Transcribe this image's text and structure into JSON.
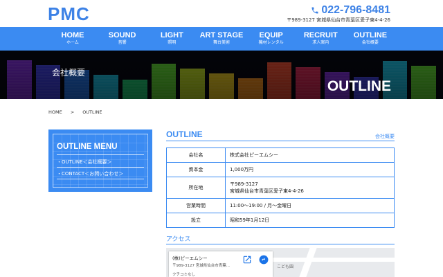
{
  "header": {
    "logo": "PMC",
    "phone": "022-796-8481",
    "address": "〒989-3127 宮城県仙台市青葉区愛子東4-4-26"
  },
  "nav": [
    {
      "en": "HOME",
      "jp": "ホーム"
    },
    {
      "en": "SOUND",
      "jp": "音響"
    },
    {
      "en": "LIGHT",
      "jp": "照明"
    },
    {
      "en": "ART STAGE",
      "jp": "舞台美術"
    },
    {
      "en": "EQUIP",
      "jp": "機材レンタル"
    },
    {
      "en": "RECRUIT",
      "jp": "求人案内"
    },
    {
      "en": "OUTLINE",
      "jp": "会社概要"
    }
  ],
  "hero": {
    "title_jp": "会社概要",
    "title_en": "OUTLINE",
    "bar_colors": [
      "#7a2bd0",
      "#3a3bd8",
      "#1e6ee0",
      "#16b8d8",
      "#19c26a",
      "#5ad02a",
      "#b8d51c",
      "#e6c41a",
      "#ee8a18",
      "#e5482a",
      "#d2244f",
      "#7a2bd0",
      "#3a3bd8",
      "#16b8d8",
      "#5ad02a"
    ]
  },
  "breadcrumb": {
    "home": "HOME",
    "sep": ">",
    "current": "OUTLINE"
  },
  "sidebar": {
    "title": "OUTLINE MENU",
    "links": [
      "・OUTLINE＜会社概要＞",
      "・CONTACT＜お問い合わせ＞"
    ]
  },
  "section": {
    "title": "OUTLINE",
    "subtitle": "会社概要"
  },
  "company_table": [
    {
      "label": "会社名",
      "value": "株式会社ピーエムシー"
    },
    {
      "label": "資本金",
      "value": "1,000万円"
    },
    {
      "label": "所在地",
      "value": "〒989-3127",
      "value2": "宮城県仙台市青葉区愛子東4-4-26"
    },
    {
      "label": "営業時間",
      "value": "11:00〜19:00 / 月〜金曜日"
    },
    {
      "label": "設立",
      "value": "昭和59年1月12日"
    }
  ],
  "access": {
    "title": "アクセス",
    "map_name": "(株)ピーエムシー",
    "map_address": "〒989-3127 宮城県仙台市青葉...",
    "map_reviews": "クチコミなし",
    "map_poi": "こども園"
  },
  "colors": {
    "brand": "#3b8bf2",
    "logo": "#3d82e6"
  }
}
